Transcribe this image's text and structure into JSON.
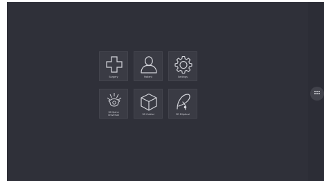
{
  "tiles": [
    {
      "label": "Surgery",
      "icon": "medical-cross-icon"
    },
    {
      "label": "Patient",
      "icon": "patient-person-icon"
    },
    {
      "label": "Settings",
      "icon": "gear-icon"
    },
    {
      "label": "3D Spine\nUniversal",
      "icon": "spine-vertebra-icon"
    },
    {
      "label": "3D Orbital",
      "icon": "cube-3d-icon"
    },
    {
      "label": "3D Elliptical",
      "icon": "elliptical-tool-icon"
    }
  ],
  "apps_button": {
    "icon": "apps-grid-icon"
  },
  "colors": {
    "background": "#2f3039",
    "tile": "#3a3b44",
    "tile_border": "#43444d",
    "icon_stroke": "#d5d6dc",
    "label": "#cfd0d6"
  }
}
